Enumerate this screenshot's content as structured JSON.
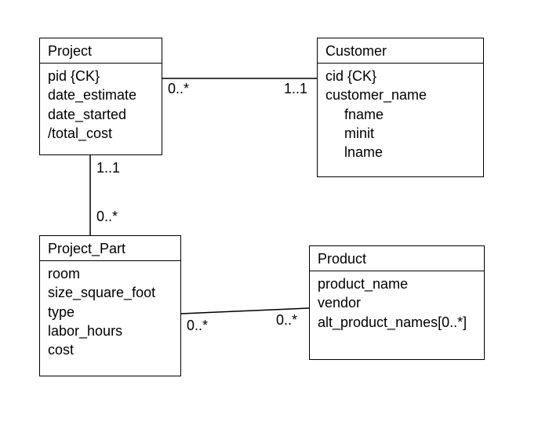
{
  "classes": {
    "project": {
      "title": "Project",
      "attrs": [
        "pid {CK}",
        "date_estimate",
        "date_started",
        "/total_cost"
      ]
    },
    "customer": {
      "title": "Customer",
      "attrs": [
        "cid {CK}",
        "customer_name"
      ],
      "nested": [
        "fname",
        "minit",
        "lname"
      ]
    },
    "project_part": {
      "title": "Project_Part",
      "attrs": [
        "room",
        "size_square_foot",
        "type",
        "labor_hours",
        "cost"
      ]
    },
    "product": {
      "title": "Product",
      "attrs": [
        "product_name",
        "vendor",
        "alt_product_names[0..*]"
      ]
    }
  },
  "associations": {
    "project_customer": {
      "left_mult": "0..*",
      "right_mult": "1..1"
    },
    "project_projectpart": {
      "top_mult": "1..1",
      "bottom_mult": "0..*"
    },
    "projectpart_product": {
      "left_mult": "0..*",
      "right_mult": "0..*"
    }
  }
}
